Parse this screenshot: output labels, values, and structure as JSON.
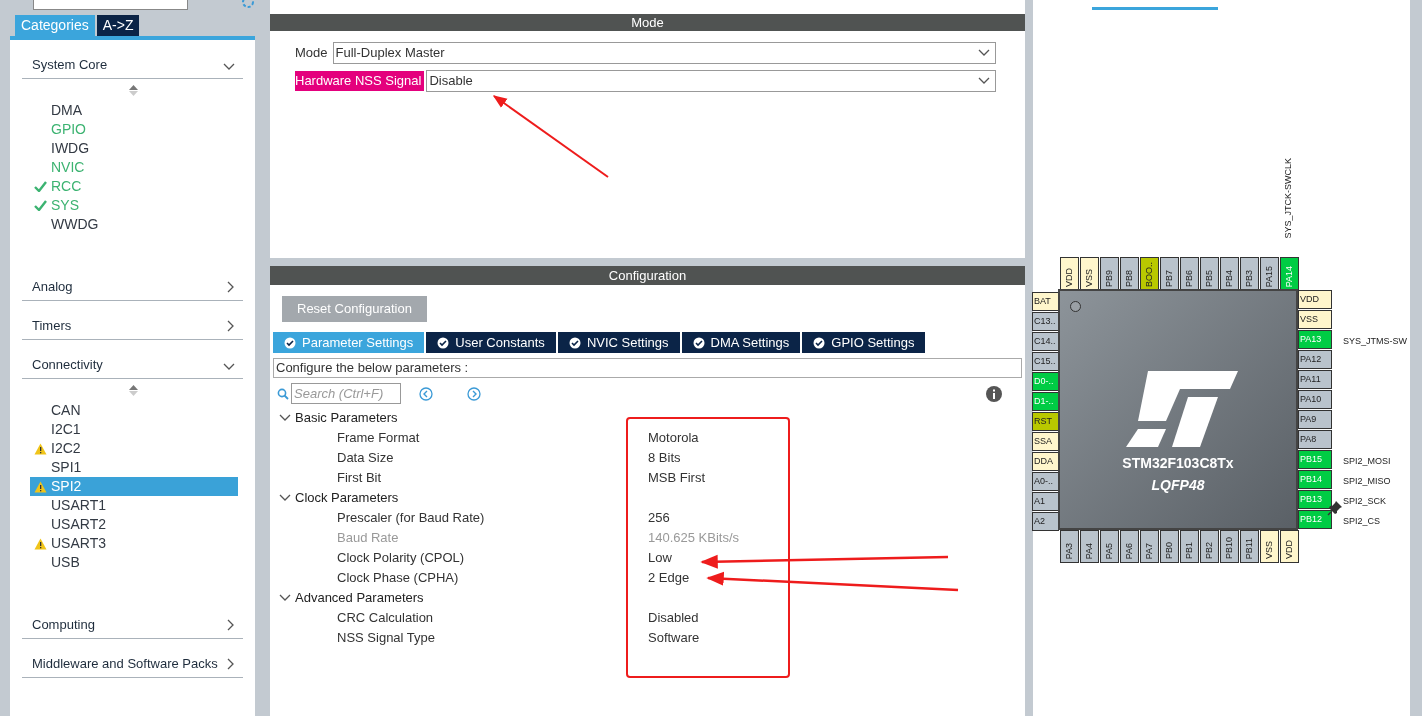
{
  "left_panel": {
    "tabs": [
      {
        "label": "Categories",
        "selected": true
      },
      {
        "label": "A->Z",
        "selected": false
      }
    ],
    "categories": [
      {
        "name": "System Core",
        "expanded": true,
        "items": [
          {
            "label": "DMA",
            "kind": "none",
            "selected": false
          },
          {
            "label": "GPIO",
            "kind": "enabled",
            "selected": false
          },
          {
            "label": "IWDG",
            "kind": "none",
            "selected": false
          },
          {
            "label": "NVIC",
            "kind": "enabled",
            "selected": false
          },
          {
            "label": "RCC",
            "kind": "configured",
            "selected": false
          },
          {
            "label": "SYS",
            "kind": "configured",
            "selected": false
          },
          {
            "label": "WWDG",
            "kind": "none",
            "selected": false
          }
        ]
      },
      {
        "name": "Analog",
        "expanded": false
      },
      {
        "name": "Timers",
        "expanded": false
      },
      {
        "name": "Connectivity",
        "expanded": true,
        "items": [
          {
            "label": "CAN",
            "kind": "none",
            "selected": false
          },
          {
            "label": "I2C1",
            "kind": "none",
            "selected": false
          },
          {
            "label": "I2C2",
            "kind": "warning",
            "selected": false
          },
          {
            "label": "SPI1",
            "kind": "none",
            "selected": false
          },
          {
            "label": "SPI2",
            "kind": "warning",
            "selected": true
          },
          {
            "label": "USART1",
            "kind": "none",
            "selected": false
          },
          {
            "label": "USART2",
            "kind": "none",
            "selected": false
          },
          {
            "label": "USART3",
            "kind": "warning",
            "selected": false
          },
          {
            "label": "USB",
            "kind": "none",
            "selected": false
          }
        ]
      },
      {
        "name": "Computing",
        "expanded": false
      },
      {
        "name": "Middleware and Software Packs",
        "expanded": false
      }
    ]
  },
  "mode_panel": {
    "title": "Mode",
    "fields": [
      {
        "label": "Mode",
        "value": "Full-Duplex Master",
        "highlighted": false
      },
      {
        "label": "Hardware NSS Signal",
        "value": "Disable",
        "highlighted": true
      }
    ]
  },
  "config_panel": {
    "title": "Configuration",
    "reset_button": "Reset Configuration",
    "tabs": [
      {
        "label": "Parameter Settings",
        "selected": true
      },
      {
        "label": "User Constants",
        "selected": false
      },
      {
        "label": "NVIC Settings",
        "selected": false
      },
      {
        "label": "DMA Settings",
        "selected": false
      },
      {
        "label": "GPIO Settings",
        "selected": false
      }
    ],
    "hint": "Configure the below parameters :",
    "search_placeholder": "Search (Ctrl+F)",
    "groups": [
      {
        "name": "Basic Parameters",
        "expanded": true,
        "children": [
          {
            "name": "Frame Format",
            "value": "Motorola",
            "disabled": false
          },
          {
            "name": "Data Size",
            "value": "8 Bits",
            "disabled": false
          },
          {
            "name": "First Bit",
            "value": "MSB First",
            "disabled": false
          }
        ]
      },
      {
        "name": "Clock Parameters",
        "expanded": true,
        "children": [
          {
            "name": "Prescaler (for Baud Rate)",
            "value": "256",
            "disabled": false
          },
          {
            "name": "Baud Rate",
            "value": "140.625 KBits/s",
            "disabled": true
          },
          {
            "name": "Clock Polarity (CPOL)",
            "value": "Low",
            "disabled": false
          },
          {
            "name": "Clock Phase (CPHA)",
            "value": "2 Edge",
            "disabled": false
          }
        ]
      },
      {
        "name": "Advanced Parameters",
        "expanded": true,
        "children": [
          {
            "name": "CRC Calculation",
            "value": "Disabled",
            "disabled": false
          },
          {
            "name": "NSS Signal Type",
            "value": "Software",
            "disabled": false
          }
        ]
      }
    ]
  },
  "pinout": {
    "part": "STM32F103C8Tx",
    "package": "LQFP48",
    "top_pins": [
      {
        "label": "VDD",
        "kind": "power"
      },
      {
        "label": "VSS",
        "kind": "power"
      },
      {
        "label": "PB9",
        "kind": "io"
      },
      {
        "label": "PB8",
        "kind": "io"
      },
      {
        "label": "BOO..",
        "kind": "boot"
      },
      {
        "label": "PB7",
        "kind": "io"
      },
      {
        "label": "PB6",
        "kind": "io"
      },
      {
        "label": "PB5",
        "kind": "io"
      },
      {
        "label": "PB4",
        "kind": "io"
      },
      {
        "label": "PB3",
        "kind": "io"
      },
      {
        "label": "PA15",
        "kind": "io"
      },
      {
        "label": "PA14",
        "kind": "active",
        "signal": "SYS_JTCK-SWCLK"
      }
    ],
    "left_pins": [
      {
        "label": "BAT",
        "kind": "power"
      },
      {
        "label": "C13..",
        "kind": "io"
      },
      {
        "label": "C14..",
        "kind": "io"
      },
      {
        "label": "C15..",
        "kind": "io"
      },
      {
        "label": "D0-..",
        "kind": "active"
      },
      {
        "label": "D1-..",
        "kind": "active"
      },
      {
        "label": "RST",
        "kind": "boot"
      },
      {
        "label": "SSA",
        "kind": "power"
      },
      {
        "label": "DDA",
        "kind": "power"
      },
      {
        "label": "A0-..",
        "kind": "io"
      },
      {
        "label": "A1",
        "kind": "io"
      },
      {
        "label": "A2",
        "kind": "io"
      }
    ],
    "right_pins": [
      {
        "label": "VDD",
        "kind": "power"
      },
      {
        "label": "VSS",
        "kind": "power"
      },
      {
        "label": "PA13",
        "kind": "active",
        "signal": "SYS_JTMS-SW"
      },
      {
        "label": "PA12",
        "kind": "io"
      },
      {
        "label": "PA11",
        "kind": "io"
      },
      {
        "label": "PA10",
        "kind": "io"
      },
      {
        "label": "PA9",
        "kind": "io"
      },
      {
        "label": "PA8",
        "kind": "io"
      },
      {
        "label": "PB15",
        "kind": "active",
        "signal": "SPI2_MOSI"
      },
      {
        "label": "PB14",
        "kind": "active",
        "signal": "SPI2_MISO"
      },
      {
        "label": "PB13",
        "kind": "active",
        "signal": "SPI2_SCK"
      },
      {
        "label": "PB12",
        "kind": "active",
        "signal": "SPI2_CS"
      }
    ],
    "bottom_pins": [
      {
        "label": "PA3",
        "kind": "io"
      },
      {
        "label": "PA4",
        "kind": "io"
      },
      {
        "label": "PA5",
        "kind": "io"
      },
      {
        "label": "PA6",
        "kind": "io"
      },
      {
        "label": "PA7",
        "kind": "io"
      },
      {
        "label": "PB0",
        "kind": "io"
      },
      {
        "label": "PB1",
        "kind": "io"
      },
      {
        "label": "PB2",
        "kind": "io"
      },
      {
        "label": "PB10",
        "kind": "io"
      },
      {
        "label": "PB11",
        "kind": "io"
      },
      {
        "label": "VSS",
        "kind": "power"
      },
      {
        "label": "VDD",
        "kind": "power"
      }
    ]
  }
}
